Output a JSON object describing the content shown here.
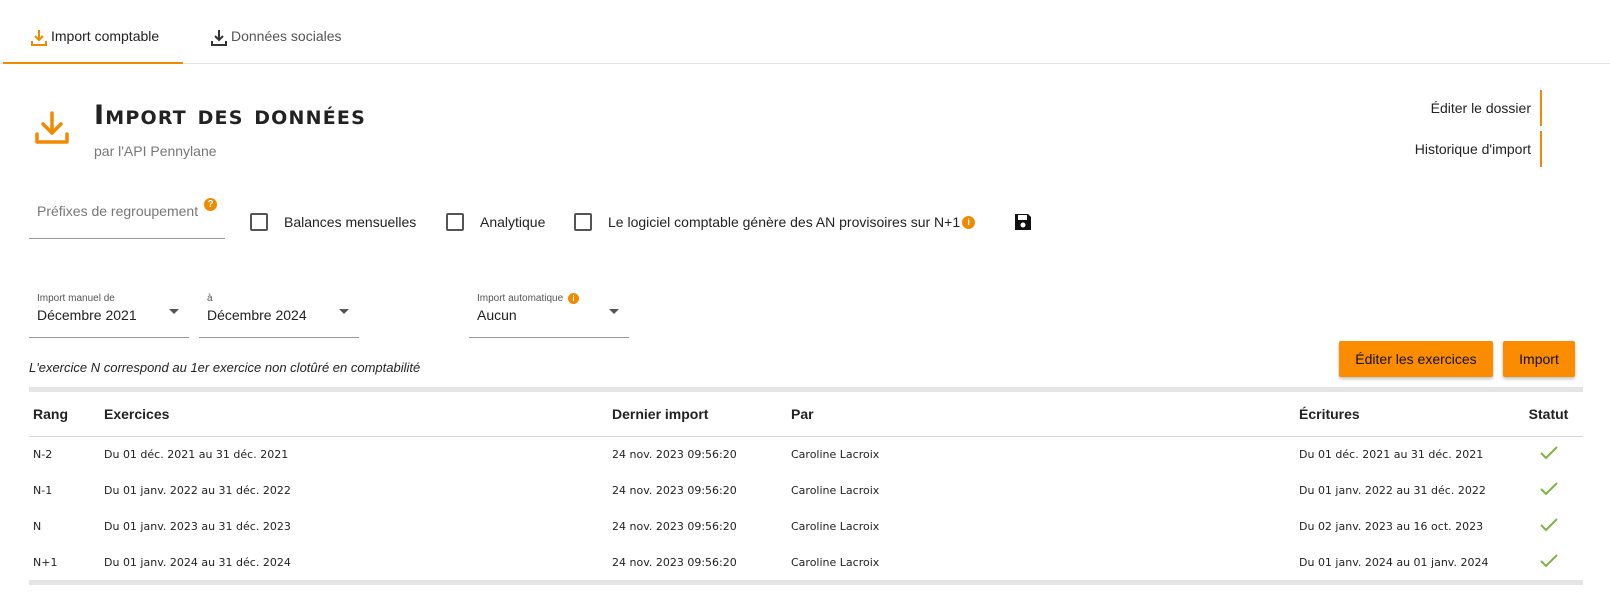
{
  "tabs": [
    {
      "label": "Import comptable",
      "active": true
    },
    {
      "label": "Données sociales",
      "active": false
    }
  ],
  "header": {
    "title": "Import des données",
    "subtitle": "par l'API Pennylane"
  },
  "right_links": [
    {
      "label": "Éditer le dossier"
    },
    {
      "label": "Historique d'import"
    }
  ],
  "options": {
    "prefix_placeholder": "Préfixes de regroupement",
    "checkboxes": [
      {
        "label": "Balances mensuelles",
        "checked": false
      },
      {
        "label": "Analytique",
        "checked": false
      },
      {
        "label": "Le logiciel comptable génère des AN provisoires sur N+1",
        "checked": false
      }
    ]
  },
  "selects": {
    "from": {
      "label": "Import manuel de",
      "value": "Décembre 2021"
    },
    "to": {
      "label": "à",
      "value": "Décembre 2024"
    },
    "auto": {
      "label": "Import automatique",
      "value": "Aucun"
    }
  },
  "note": "L'exercice N correspond au 1er exercice non clotûré en comptabilité",
  "buttons": {
    "edit_exercises": "Éditer les exercices",
    "import": "Import"
  },
  "table": {
    "headers": [
      "Rang",
      "Exercices",
      "Dernier import",
      "Par",
      "Écritures",
      "Statut"
    ],
    "rows": [
      {
        "rang": "N-2",
        "exercices": "Du 01 déc. 2021 au 31 déc. 2021",
        "dernier_import": "24 nov. 2023 09:56:20",
        "par": "Caroline Lacroix",
        "ecritures": "Du 01 déc. 2021 au 31 déc. 2021",
        "statut": "check-icon"
      },
      {
        "rang": "N-1",
        "exercices": "Du 01 janv. 2022 au 31 déc. 2022",
        "dernier_import": "24 nov. 2023 09:56:20",
        "par": "Caroline Lacroix",
        "ecritures": "Du 01 janv. 2022 au 31 déc. 2022",
        "statut": "check-icon"
      },
      {
        "rang": "N",
        "exercices": "Du 01 janv. 2023 au 31 déc. 2023",
        "dernier_import": "24 nov. 2023 09:56:20",
        "par": "Caroline Lacroix",
        "ecritures": "Du 02 janv. 2023 au 16 oct. 2023",
        "statut": "check-icon"
      },
      {
        "rang": "N+1",
        "exercices": "Du 01 janv. 2024 au 31 déc. 2024",
        "dernier_import": "24 nov. 2023 09:56:20",
        "par": "Caroline Lacroix",
        "ecritures": "Du 01 janv. 2024 au 01 janv. 2024",
        "statut": "check-icon"
      }
    ]
  },
  "colors": {
    "accent": "#f08a00",
    "button": "#fb8c00",
    "success": "#7cb342"
  }
}
